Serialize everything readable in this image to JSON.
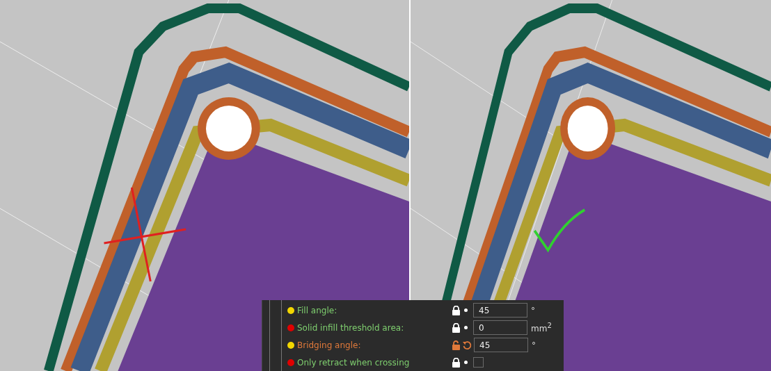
{
  "views": [
    {
      "kind": "cross"
    },
    {
      "kind": "check"
    }
  ],
  "settings": [
    {
      "label": "Fill angle:",
      "color": "#f2d600",
      "modified": false,
      "kind": "number",
      "value": "45",
      "unit": "°"
    },
    {
      "label": "Solid infill threshold area:",
      "color": "#e00000",
      "modified": false,
      "kind": "number",
      "value": "0",
      "unit": "mm$^{2}$"
    },
    {
      "label": "Bridging angle:",
      "color": "#f2d600",
      "modified": true,
      "kind": "number",
      "value": "45",
      "unit": "°"
    },
    {
      "label": "Only retract when crossing",
      "color": "#e00000",
      "modified": false,
      "kind": "checkbox",
      "checked": false
    }
  ]
}
